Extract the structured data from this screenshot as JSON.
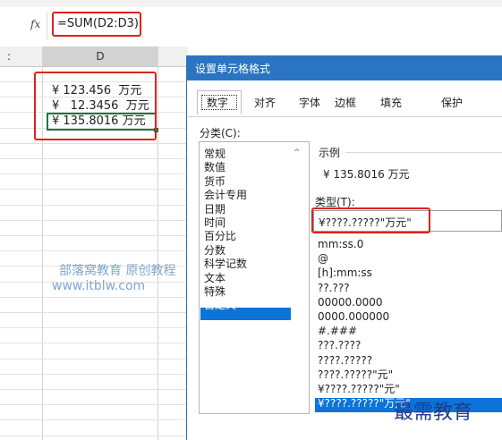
{
  "formula_bar": {
    "fx_label": "fx",
    "formula": "=SUM(D2:D3)"
  },
  "columns": {
    "c_label": ":",
    "d_label": "D"
  },
  "cells": [
    "¥ 123.456  万元",
    "¥   12.3456  万元",
    "¥ 135.8016 万元"
  ],
  "watermark": {
    "line1": "部落窝教育  原创教程",
    "line2": "www.itblw.com"
  },
  "dialog": {
    "title": "设置单元格格式",
    "tabs": [
      "数字",
      "对齐",
      "字体",
      "边框",
      "填充",
      "保护"
    ],
    "category_label": "分类(C):",
    "categories": [
      "常规",
      "数值",
      "货币",
      "会计专用",
      "日期",
      "时间",
      "百分比",
      "分数",
      "科学记数",
      "文本",
      "特殊",
      "自定义"
    ],
    "selected_category": "自定义",
    "sample_label": "示例",
    "sample_value": "¥ 135.8016 万元",
    "type_label": "类型(T):",
    "type_value": "¥????.?????\"万元\"",
    "formats": [
      "mm:ss.0",
      "@",
      "[h]:mm:ss",
      "??.???",
      "00000.0000",
      "0000.000000",
      "#.###",
      "???.????",
      "????.?????",
      "????.?????\"元\"",
      "¥????.?????\"元\"",
      "¥????.?????\"万元\""
    ]
  },
  "brand": "最需教育",
  "colors": {
    "accent_red": "#e0211b",
    "dialog_title": "#2b74c1",
    "selection": "#0c73d8",
    "cell_border": "#217346"
  }
}
